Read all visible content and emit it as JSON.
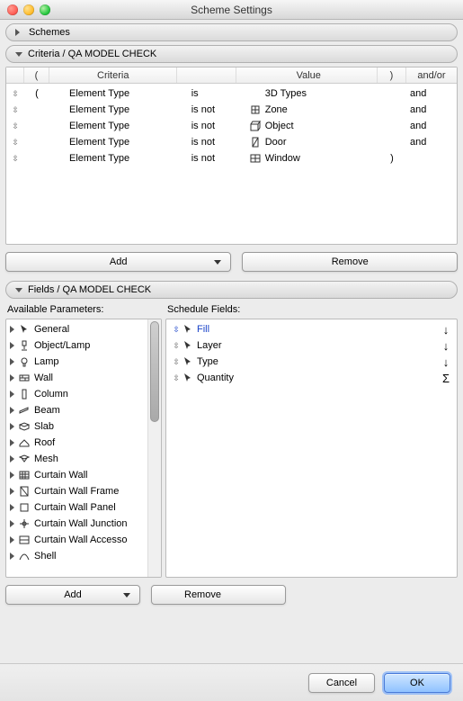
{
  "window": {
    "title": "Scheme Settings"
  },
  "sections": {
    "schemes": {
      "label": "Schemes",
      "expanded": false
    },
    "criteria": {
      "label": "Criteria / QA MODEL CHECK",
      "expanded": true
    },
    "fields": {
      "label": "Fields / QA MODEL CHECK",
      "expanded": true
    }
  },
  "criteria": {
    "headers": {
      "open": "(",
      "criteria": "Criteria",
      "value": "Value",
      "close": ")",
      "andor": "and/or"
    },
    "rows": [
      {
        "open": "(",
        "criteria": "Element Type",
        "operator": "is",
        "icon": "",
        "value": "3D Types",
        "close": "",
        "andor": "and"
      },
      {
        "open": "",
        "criteria": "Element Type",
        "operator": "is not",
        "icon": "zone",
        "value": "Zone",
        "close": "",
        "andor": "and"
      },
      {
        "open": "",
        "criteria": "Element Type",
        "operator": "is not",
        "icon": "object",
        "value": "Object",
        "close": "",
        "andor": "and"
      },
      {
        "open": "",
        "criteria": "Element Type",
        "operator": "is not",
        "icon": "door",
        "value": "Door",
        "close": "",
        "andor": "and"
      },
      {
        "open": "",
        "criteria": "Element Type",
        "operator": "is not",
        "icon": "window",
        "value": "Window",
        "close": ")",
        "andor": ""
      }
    ],
    "buttons": {
      "add": "Add",
      "remove": "Remove"
    }
  },
  "fields": {
    "available_label": "Available Parameters:",
    "schedule_label": "Schedule Fields:",
    "available": [
      {
        "icon": "pointer",
        "label": "General"
      },
      {
        "icon": "lamp",
        "label": "Object/Lamp"
      },
      {
        "icon": "bulb",
        "label": "Lamp"
      },
      {
        "icon": "wall",
        "label": "Wall"
      },
      {
        "icon": "column",
        "label": "Column"
      },
      {
        "icon": "beam",
        "label": "Beam"
      },
      {
        "icon": "slab",
        "label": "Slab"
      },
      {
        "icon": "roof",
        "label": "Roof"
      },
      {
        "icon": "mesh",
        "label": "Mesh"
      },
      {
        "icon": "cwall",
        "label": "Curtain Wall"
      },
      {
        "icon": "cframe",
        "label": "Curtain Wall Frame"
      },
      {
        "icon": "cpanel",
        "label": "Curtain Wall Panel"
      },
      {
        "icon": "cjunc",
        "label": "Curtain Wall Junction"
      },
      {
        "icon": "cacc",
        "label": "Curtain Wall Accesso"
      },
      {
        "icon": "shell",
        "label": "Shell"
      }
    ],
    "schedule": [
      {
        "label": "Fill",
        "agg": "↓",
        "selected": true
      },
      {
        "label": "Layer",
        "agg": "↓",
        "selected": false
      },
      {
        "label": "Type",
        "agg": "↓",
        "selected": false
      },
      {
        "label": "Quantity",
        "agg": "Σ",
        "selected": false
      }
    ],
    "buttons": {
      "add": "Add",
      "remove": "Remove"
    }
  },
  "footer": {
    "cancel": "Cancel",
    "ok": "OK"
  }
}
